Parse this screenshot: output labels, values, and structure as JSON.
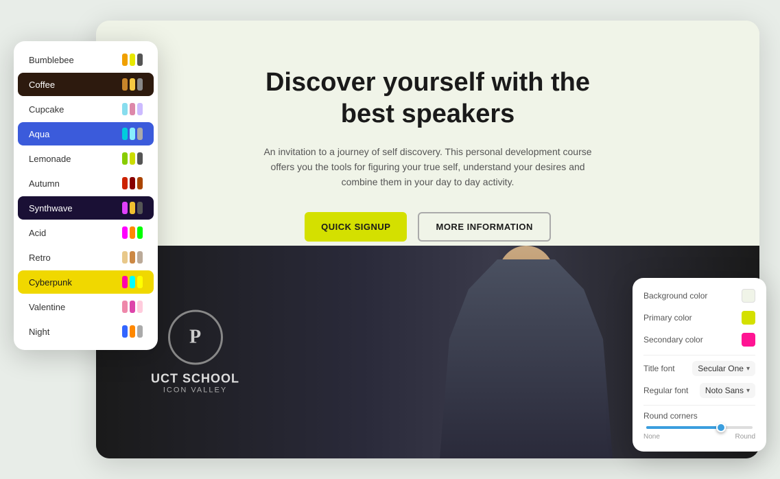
{
  "page": {
    "background_color": "#e8ede8"
  },
  "hero": {
    "title": "Discover yourself with the best speakers",
    "subtitle": "An invitation to a journey of self discovery. This personal development course offers you the tools for figuring your true self, understand your desires and combine them in your day to day activity.",
    "btn_primary": "QUICK SIGNUP",
    "btn_secondary": "MORE INFORMATION"
  },
  "school": {
    "logo_letter": "P",
    "name": "UCT SCHOOL",
    "subtitle": "ICON VALLEY"
  },
  "themes": {
    "items": [
      {
        "name": "Bumblebee",
        "active": false,
        "colors": [
          "#f0a000",
          "#e8e800",
          "#888888"
        ]
      },
      {
        "name": "Coffee",
        "active": true,
        "style": "active-coffee",
        "colors": [
          "#c8852a",
          "#f5c842",
          "#888888"
        ]
      },
      {
        "name": "Cupcake",
        "active": false,
        "colors": [
          "#88ddee",
          "#dd88aa",
          "#888888"
        ]
      },
      {
        "name": "Aqua",
        "active": true,
        "style": "active-aqua",
        "colors": [
          "#00ccdd",
          "#f0f0f0",
          "#888888"
        ]
      },
      {
        "name": "Lemonade",
        "active": false,
        "colors": [
          "#88cc00",
          "#ffffff",
          "#888888"
        ]
      },
      {
        "name": "Autumn",
        "active": false,
        "colors": [
          "#cc2200",
          "#880000",
          "#888888"
        ]
      },
      {
        "name": "Synthwave",
        "active": true,
        "style": "active-synthwave",
        "colors": [
          "#e040fb",
          "#f0c030",
          "#888888"
        ]
      },
      {
        "name": "Acid",
        "active": false,
        "colors": [
          "#ff00ff",
          "#ff8800",
          "#888888"
        ]
      },
      {
        "name": "Retro",
        "active": false,
        "colors": [
          "#e8c88a",
          "#cc8844",
          "#888888"
        ]
      },
      {
        "name": "Cyberpunk",
        "active": true,
        "style": "active-cyberpunk",
        "colors": [
          "#ff00aa",
          "#00ffff",
          "#888888"
        ]
      },
      {
        "name": "Valentine",
        "active": false,
        "colors": [
          "#ee88aa",
          "#dd44aa",
          "#888888"
        ]
      },
      {
        "name": "Night",
        "active": false,
        "colors": [
          "#3366ff",
          "#ff8800",
          "#888888"
        ]
      }
    ]
  },
  "settings": {
    "background_color_label": "Background color",
    "primary_color_label": "Primary color",
    "secondary_color_label": "Secondary color",
    "title_font_label": "Title font",
    "title_font_value": "Secular One",
    "regular_font_label": "Regular font",
    "regular_font_value": "Noto Sans",
    "round_corners_label": "Round corners",
    "slider_min": "None",
    "slider_max": "Round",
    "bg_color": "#f0f4e8",
    "primary_color": "#d4e000",
    "secondary_color": "#ff1493"
  }
}
